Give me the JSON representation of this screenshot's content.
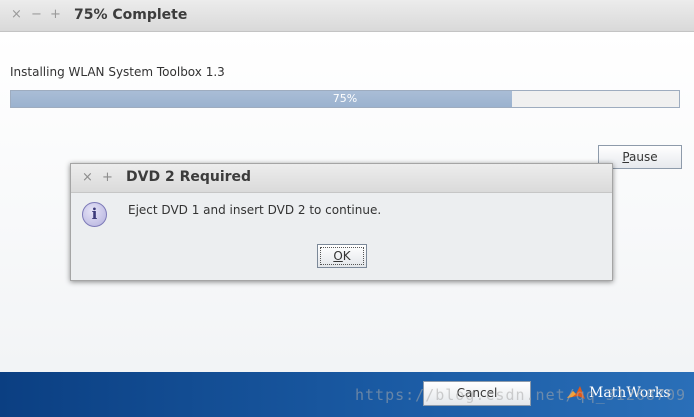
{
  "window": {
    "title": "75% Complete",
    "controls": {
      "close": "×",
      "minimize": "−",
      "maximize": "+"
    }
  },
  "installer": {
    "status_label": "Installing WLAN System Toolbox 1.3",
    "progress_percent": 75,
    "progress_text": "75%",
    "pause_label": "Pause",
    "cancel_label": "Cancel"
  },
  "footer": {
    "brand": "MathWorks",
    "watermark": "https://blog.csdn.net/qq_31268709"
  },
  "dialog": {
    "title": "DVD 2 Required",
    "controls": {
      "close": "×",
      "maximize": "+"
    },
    "icon": "info-icon",
    "icon_glyph": "i",
    "message": "Eject DVD 1 and insert DVD 2 to continue.",
    "ok_label": "OK"
  },
  "colors": {
    "progress_fill": "#a9bdd6",
    "footer_blue": "#1a5aa3",
    "logo_accent": "#e05a1b"
  }
}
